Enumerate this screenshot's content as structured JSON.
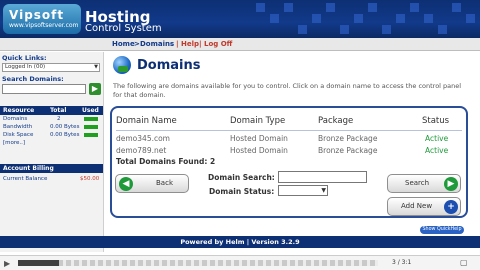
{
  "header": {
    "logo_line1": "Vipsoft",
    "logo_line2": "www.vipsoftserver.com",
    "brand_title": "Hosting",
    "brand_subtitle": "Control System"
  },
  "breadcrumb": {
    "home": "Home",
    "sep1": ">",
    "domains": "Domains",
    "sep2": "-",
    "pipe1": "|",
    "help": "Help",
    "pipe2": "|",
    "logoff": "Log Off"
  },
  "sidebar": {
    "quick_links_label": "Quick Links:",
    "quick_links_value": "Logged In (00)",
    "search_label": "Search Domains:",
    "go_label": "▶",
    "resources_head": {
      "resource": "Resource",
      "total": "Total",
      "used": "Used"
    },
    "resources": [
      {
        "name": "Domains",
        "total": "2",
        "bar": true
      },
      {
        "name": "Bandwidth",
        "total": "0.00 Bytes",
        "bar": true
      },
      {
        "name": "Disk Space",
        "total": "0.00 Bytes",
        "bar": true
      },
      {
        "name": "[more..]",
        "total": "",
        "bar": false
      }
    ],
    "account_billing": "Account Billing",
    "current_balance_label": "Current Balance",
    "current_balance_value": "$50.00",
    "colors": {
      "bar": "#1fa01f",
      "balance": "#c0392b"
    }
  },
  "main": {
    "title": "Domains",
    "intro": "The following are domains available for you to control. Click on a domain name to access the control panel for that domain.",
    "columns": [
      "Domain Name",
      "Domain Type",
      "Package",
      "Status"
    ],
    "rows": [
      {
        "name": "demo345.com",
        "type": "Hosted Domain",
        "package": "Bronze Package",
        "status": "Active"
      },
      {
        "name": "demo789.net",
        "type": "Hosted Domain",
        "package": "Bronze Package",
        "status": "Active"
      }
    ],
    "total_label": "Total Domains Found: 2",
    "back_label": "Back",
    "search_label": "Search",
    "add_new_label": "Add New",
    "domain_search_label": "Domain Search:",
    "domain_status_label": "Domain Status:"
  },
  "footer": {
    "powered_by": "Powered by Helm | Version 3.2.9",
    "quickhelp": "Show QuickHelp"
  },
  "player": {
    "time": "3 / 3:1",
    "progress_fraction": 0.115
  }
}
